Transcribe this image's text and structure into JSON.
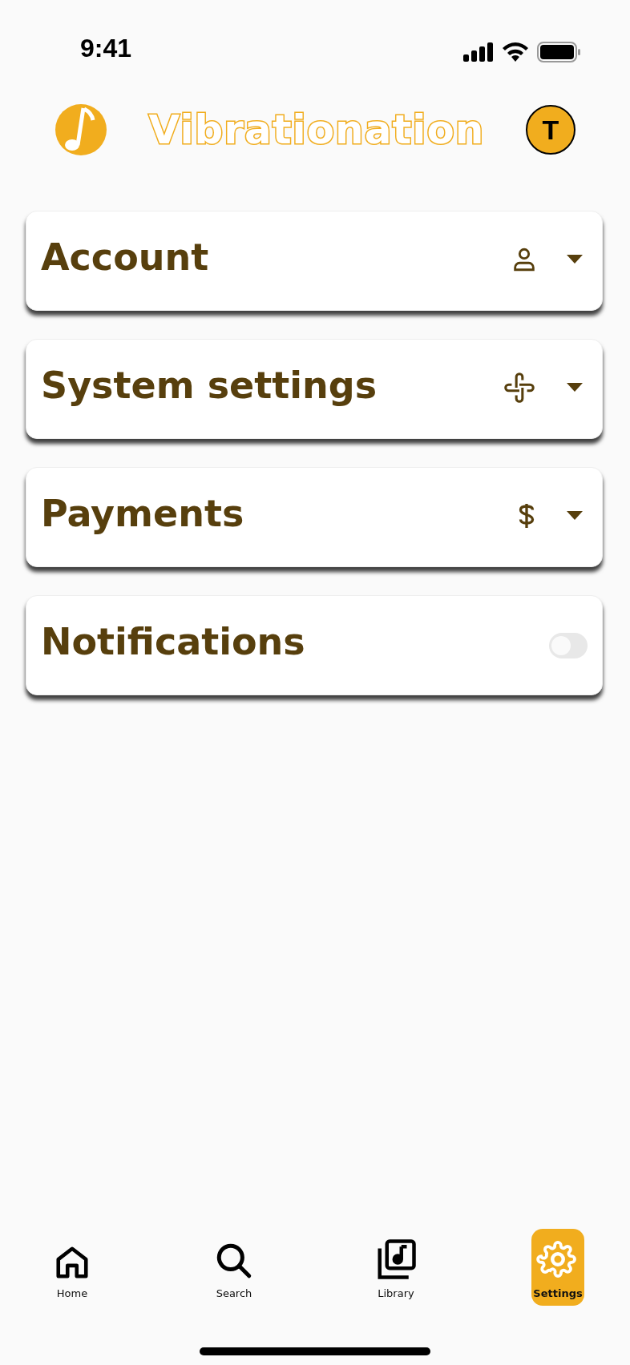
{
  "status_bar": {
    "time": "9:41"
  },
  "header": {
    "brand": "Vibrationation",
    "avatar_initial": "T"
  },
  "sections": [
    {
      "title": "Account",
      "kind": "dropdown",
      "expanded": false
    },
    {
      "title": "System settings",
      "kind": "dropdown",
      "expanded": false
    },
    {
      "title": "Payments",
      "kind": "dropdown",
      "expanded": false
    },
    {
      "title": "Notifications",
      "kind": "toggle",
      "on": false
    }
  ],
  "nav": [
    {
      "label": "Home",
      "selected": false
    },
    {
      "label": "Search",
      "selected": false
    },
    {
      "label": "Library",
      "selected": false
    },
    {
      "label": "Settings",
      "selected": true
    }
  ]
}
